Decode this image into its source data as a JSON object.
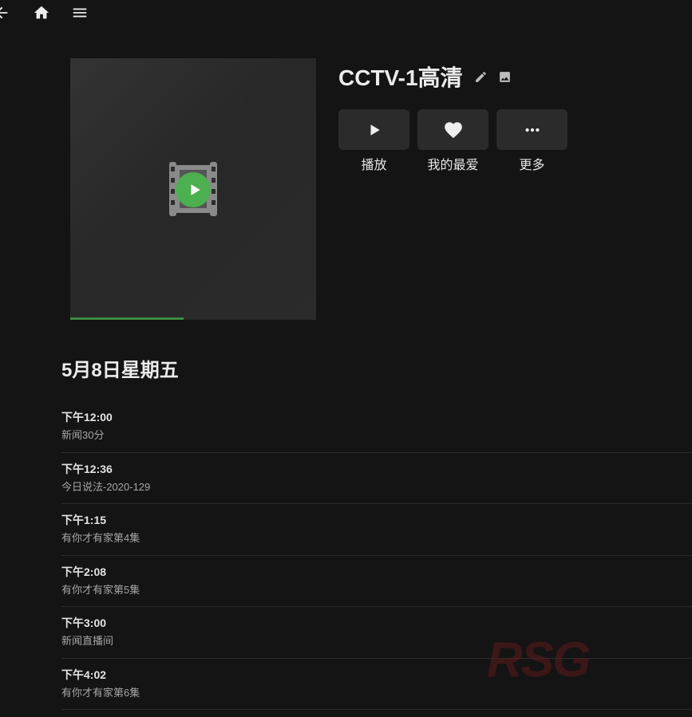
{
  "topbar": {
    "back_icon": "arrow-left-icon",
    "home_icon": "home-icon",
    "menu_icon": "menu-icon"
  },
  "channel": {
    "title": "CCTV-1高清",
    "edit_icon": "pencil-icon",
    "image_icon": "image-icon",
    "progress_fraction": 0.46
  },
  "actions": [
    {
      "label": "播放",
      "icon": "play-icon"
    },
    {
      "label": "我的最爱",
      "icon": "heart-icon"
    },
    {
      "label": "更多",
      "icon": "more-horizontal-icon"
    }
  ],
  "guide": {
    "date": "5月8日星期五",
    "programs": [
      {
        "time": "下午12:00",
        "title": "新闻30分"
      },
      {
        "time": "下午12:36",
        "title": "今日说法-2020-129"
      },
      {
        "time": "下午1:15",
        "title": "有你才有家第4集"
      },
      {
        "time": "下午2:08",
        "title": "有你才有家第5集"
      },
      {
        "time": "下午3:00",
        "title": "新闻直播间"
      },
      {
        "time": "下午4:02",
        "title": "有你才有家第6集"
      }
    ]
  },
  "watermark": "RSG",
  "colors": {
    "background": "#141414",
    "accent_green": "#4caf50",
    "button_bg": "#2b2b2b"
  }
}
